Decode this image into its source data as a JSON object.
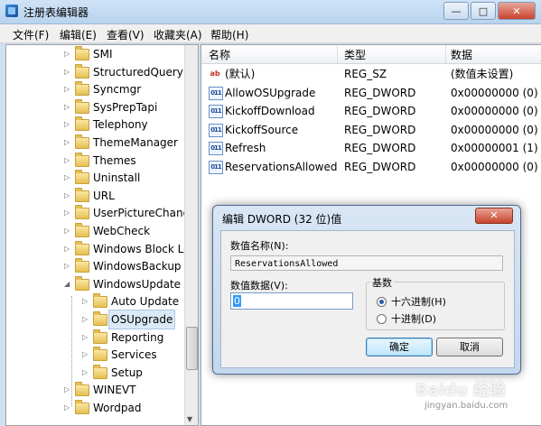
{
  "window": {
    "title": "注册表编辑器",
    "buttons": {
      "min": "—",
      "max": "□",
      "close": "✕"
    }
  },
  "menu": [
    "文件(F)",
    "编辑(E)",
    "查看(V)",
    "收藏夹(A)",
    "帮助(H)"
  ],
  "tree": [
    {
      "label": "SMI",
      "depth": 0
    },
    {
      "label": "StructuredQuery",
      "depth": 0
    },
    {
      "label": "Syncmgr",
      "depth": 0
    },
    {
      "label": "SysPrepTapi",
      "depth": 0
    },
    {
      "label": "Telephony",
      "depth": 0
    },
    {
      "label": "ThemeManager",
      "depth": 0
    },
    {
      "label": "Themes",
      "depth": 0
    },
    {
      "label": "Uninstall",
      "depth": 0
    },
    {
      "label": "URL",
      "depth": 0
    },
    {
      "label": "UserPictureChang",
      "depth": 0
    },
    {
      "label": "WebCheck",
      "depth": 0
    },
    {
      "label": "Windows Block Le",
      "depth": 0
    },
    {
      "label": "WindowsBackup",
      "depth": 0
    },
    {
      "label": "WindowsUpdate",
      "depth": 0,
      "expanded": true
    },
    {
      "label": "Auto Update",
      "depth": 1
    },
    {
      "label": "OSUpgrade",
      "depth": 1,
      "selected": true
    },
    {
      "label": "Reporting",
      "depth": 1
    },
    {
      "label": "Services",
      "depth": 1
    },
    {
      "label": "Setup",
      "depth": 1
    },
    {
      "label": "WINEVT",
      "depth": 0
    },
    {
      "label": "Wordpad",
      "depth": 0
    }
  ],
  "list": {
    "headers": {
      "name": "名称",
      "type": "类型",
      "data": "数据"
    },
    "rows": [
      {
        "icon": "ab",
        "name": "(默认)",
        "type": "REG_SZ",
        "data": "(数值未设置)"
      },
      {
        "icon": "bin",
        "name": "AllowOSUpgrade",
        "type": "REG_DWORD",
        "data": "0x00000000 (0)"
      },
      {
        "icon": "bin",
        "name": "KickoffDownload",
        "type": "REG_DWORD",
        "data": "0x00000000 (0)"
      },
      {
        "icon": "bin",
        "name": "KickoffSource",
        "type": "REG_DWORD",
        "data": "0x00000000 (0)"
      },
      {
        "icon": "bin",
        "name": "Refresh",
        "type": "REG_DWORD",
        "data": "0x00000001 (1)"
      },
      {
        "icon": "bin",
        "name": "ReservationsAllowed",
        "type": "REG_DWORD",
        "data": "0x00000000 (0)"
      }
    ]
  },
  "dialog": {
    "title": "编辑 DWORD (32 位)值",
    "close": "✕",
    "name_label": "数值名称(N):",
    "name_value": "ReservationsAllowed",
    "data_label": "数值数据(V):",
    "data_value": "0",
    "base_label": "基数",
    "hex_label": "十六进制(H)",
    "dec_label": "十进制(D)",
    "ok": "确定",
    "cancel": "取消"
  },
  "watermark": {
    "text": "Baidu 经验",
    "sub": "jingyan.baidu.com"
  }
}
